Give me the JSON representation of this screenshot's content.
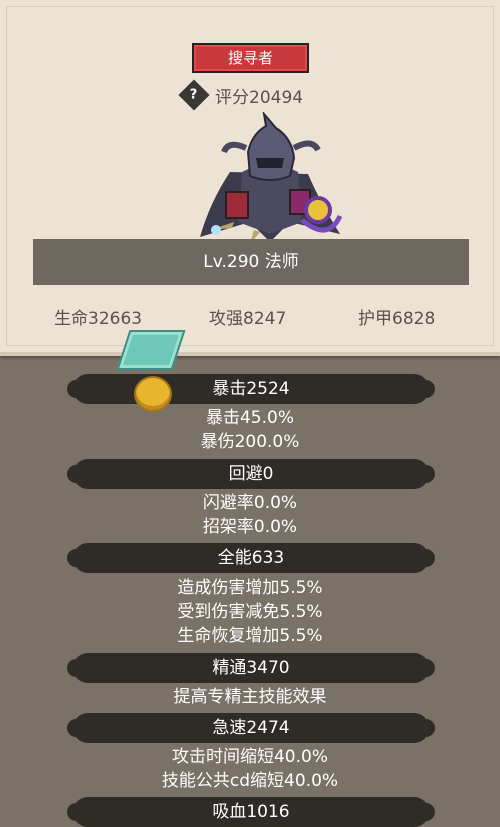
{
  "header": {
    "title_badge": "搜寻者",
    "rating_icon": "?",
    "rating_text": "评分20494",
    "level_text": "Lv.290 法师"
  },
  "base_stats": {
    "hp": "生命32663",
    "attack": "攻强8247",
    "armor": "护甲6828"
  },
  "sections": [
    {
      "title": "暴击2524",
      "lines": [
        "暴击45.0%",
        "暴伤200.0%"
      ]
    },
    {
      "title": "回避0",
      "lines": [
        "闪避率0.0%",
        "招架率0.0%"
      ]
    },
    {
      "title": "全能633",
      "lines": [
        "造成伤害增加5.5%",
        "受到伤害减免5.5%",
        "生命恢复增加5.5%"
      ]
    },
    {
      "title": "精通3470",
      "lines": [
        "提高专精主技能效果"
      ]
    },
    {
      "title": "急速2474",
      "lines": [
        "攻击时间缩短40.0%",
        "技能公共cd缩短40.0%"
      ]
    },
    {
      "title": "吸血1016",
      "lines": []
    }
  ],
  "colors": {
    "badge_red": "#c9383a",
    "parchment": "#ece3d5",
    "background": "#7b7267",
    "bar_dark": "#2f2b27"
  }
}
